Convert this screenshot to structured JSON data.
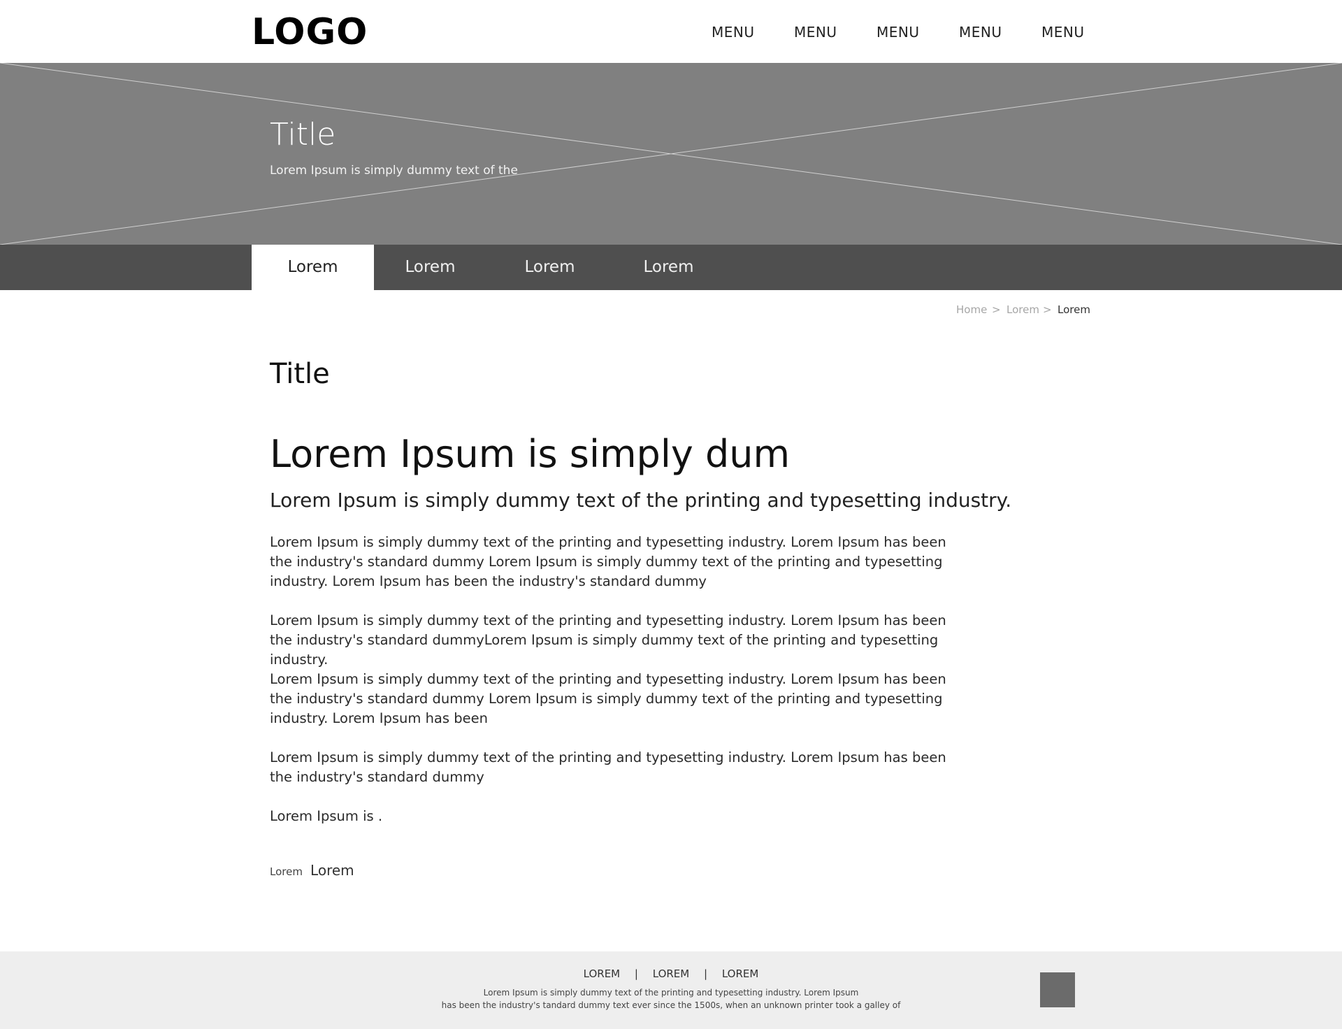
{
  "header": {
    "logo": "LOGO",
    "menu": [
      "MENU",
      "MENU",
      "MENU",
      "MENU",
      "MENU"
    ]
  },
  "hero": {
    "title": "Title",
    "subtitle": "Lorem Ipsum is simply dummy text of the"
  },
  "tabs": [
    {
      "label": "Lorem",
      "active": true
    },
    {
      "label": "Lorem",
      "active": false
    },
    {
      "label": "Lorem",
      "active": false
    },
    {
      "label": "Lorem",
      "active": false
    }
  ],
  "breadcrumb": {
    "items": [
      "Home",
      "Lorem",
      "Lorem"
    ],
    "separator": ">"
  },
  "main": {
    "title": "Title",
    "headline": "Lorem Ipsum is simply dum",
    "subheadline": "Lorem Ipsum is simply dummy text of the printing and typesetting industry.",
    "paragraphs": [
      "Lorem Ipsum is simply dummy text of the printing and typesetting industry. Lorem Ipsum has been the industry's standard dummy Lorem Ipsum is simply dummy text of the printing and typesetting industry. Lorem Ipsum has been the industry's standard dummy",
      "Lorem Ipsum is simply dummy text of the printing and typesetting industry. Lorem Ipsum has been the industry's standard dummyLorem Ipsum is simply dummy text of the printing and typesetting industry.",
      "Lorem Ipsum is simply dummy text of the printing and typesetting industry. Lorem Ipsum has been the industry's standard dummy  Lorem Ipsum is simply dummy text of the printing and typesetting industry. Lorem Ipsum has been",
      "Lorem Ipsum is simply dummy text of the printing and typesetting industry. Lorem Ipsum has been the industry's standard dummy",
      "Lorem Ipsum is ."
    ],
    "meta_small": "Lorem",
    "meta_large": "Lorem"
  },
  "footer": {
    "links": [
      "LOREM",
      "LOREM",
      "LOREM"
    ],
    "separator": "|",
    "text_line1": "Lorem Ipsum is simply dummy text of the printing and typesetting industry. Lorem Ipsum",
    "text_line2": "has been the industry's tandard dummy text ever since the 1500s, when an unknown printer took a galley of"
  },
  "colors": {
    "hero_bg": "#808080",
    "tabs_bg": "#4f4f4f",
    "footer_bg": "#eeeeee",
    "footer_square": "#6b6b6b"
  }
}
